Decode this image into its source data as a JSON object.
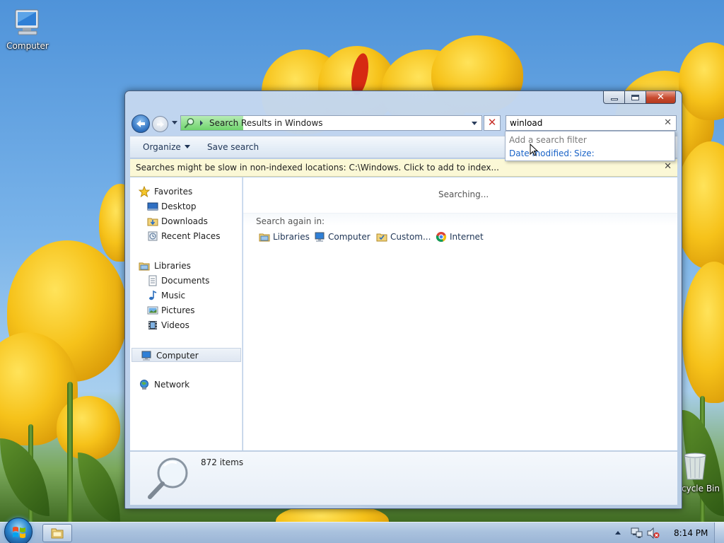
{
  "desktop": {
    "icons": [
      {
        "label": "Computer"
      },
      {
        "label": "cycle Bin"
      }
    ]
  },
  "window": {
    "address": {
      "text": "Search Results in Windows"
    },
    "search": {
      "value": "winload"
    },
    "toolbar": {
      "organize_label": "Organize",
      "save_search_label": "Save search"
    },
    "info_bar": {
      "text": "Searches might be slow in non-indexed locations: C:\\Windows. Click to add to index..."
    },
    "nav": {
      "favorites": "Favorites",
      "desktop": "Desktop",
      "downloads": "Downloads",
      "recent_places": "Recent Places",
      "libraries": "Libraries",
      "documents": "Documents",
      "music": "Music",
      "pictures": "Pictures",
      "videos": "Videos",
      "computer": "Computer",
      "network": "Network"
    },
    "content": {
      "status": "Searching...",
      "search_again_label": "Search again in:",
      "search_again_items": [
        "Libraries",
        "Computer",
        "Custom...",
        "Internet"
      ]
    },
    "details": {
      "count": "872 items"
    },
    "search_dropdown": {
      "hint": "Add a search filter",
      "filters": [
        "Date modified:",
        "Size:"
      ]
    }
  },
  "taskbar": {
    "clock": "8:14 PM"
  },
  "colors": {
    "accent": "#1a63c7",
    "info_bar": "#fbf8d6",
    "close_button": "#c74a2e",
    "progress": "#6fd46c"
  }
}
